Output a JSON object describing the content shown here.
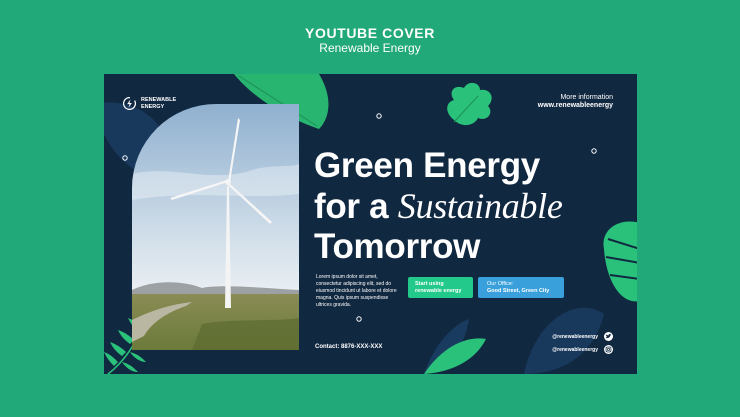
{
  "header": {
    "title": "YOUTUBE COVER",
    "subtitle": "Renewable Energy"
  },
  "card": {
    "logo_text": "RENEWABLE ENERGY",
    "more_info_label": "More information",
    "more_info_url": "www.renewableenergy",
    "headline": {
      "line1": "Green Energy",
      "line2_prefix": "for a",
      "line2_script": "Sustainable",
      "line3": "Tomorrow"
    },
    "body_text": "Lorem ipsum dolor sit amet, consectetur adipiscing elit, sed do eiusmod tincidunt ut labore et dolore magna. Quis ipsum suspendisse ultrices gravida.",
    "start_button": "Start using renewable energy",
    "office_label": "Our Office:",
    "office_address": "Good Street, Green City",
    "contact": "Contact: 8876-XXX-XXX",
    "social": [
      {
        "handle": "@renewableenergy",
        "icon": "twitter-icon"
      },
      {
        "handle": "@renewableenergy",
        "icon": "instagram-icon"
      }
    ]
  },
  "colors": {
    "page_background": "#22a97a",
    "card_background": "#112841",
    "accent_green": "#22c98a",
    "accent_blue": "#3aa0dc"
  }
}
